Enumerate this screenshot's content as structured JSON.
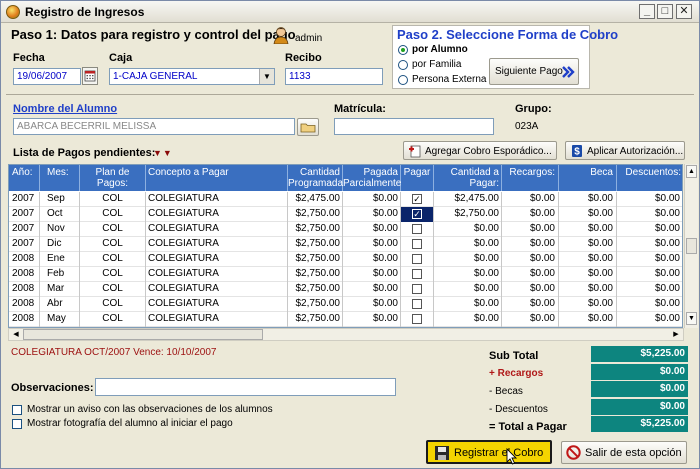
{
  "window": {
    "title": "Registro de Ingresos"
  },
  "step1": {
    "heading": "Paso 1: Datos para registro y control del pago",
    "user": "admin",
    "fecha_label": "Fecha",
    "fecha_value": "19/06/2007",
    "caja_label": "Caja",
    "caja_value": "1-CAJA GENERAL",
    "recibo_label": "Recibo",
    "recibo_value": "1133"
  },
  "step2": {
    "heading": "Paso 2. Seleccione Forma de Cobro",
    "options": [
      "por Alumno",
      "por Familia",
      "Persona Externa"
    ],
    "selected": "por Alumno",
    "next_button": "Siguiente Pago"
  },
  "student": {
    "name_label": "Nombre del Alumno",
    "name_value": "ABARCA BECERRIL MELISSA",
    "matricula_label": "Matrícula:",
    "matricula_value": "",
    "grupo_label": "Grupo:",
    "grupo_value": "023A"
  },
  "list": {
    "label": "Lista de Pagos pendientes:",
    "add_button": "Agregar Cobro Esporádico...",
    "auth_button": "Aplicar Autorización..."
  },
  "table": {
    "headers": [
      "Año:",
      "Mes:",
      "Plan de Pagos:",
      "Concepto a Pagar",
      "Cantidad Programada",
      "Pagada Parcialmente",
      "Pagar",
      "Cantidad a Pagar:",
      "Recargos:",
      "Beca",
      "Descuentos:"
    ],
    "rows": [
      {
        "anio": "2007",
        "mes": "Sep",
        "plan": "COL",
        "concepto": "COLEGIATURA",
        "programada": "$2,475.00",
        "parcial": "$0.00",
        "pagar": true,
        "cantidad": "$2,475.00",
        "recargos": "$0.00",
        "beca": "$0.00",
        "descuentos": "$0.00"
      },
      {
        "anio": "2007",
        "mes": "Oct",
        "plan": "COL",
        "concepto": "COLEGIATURA",
        "programada": "$2,750.00",
        "parcial": "$0.00",
        "pagar": true,
        "cantidad": "$2,750.00",
        "recargos": "$0.00",
        "beca": "$0.00",
        "descuentos": "$0.00"
      },
      {
        "anio": "2007",
        "mes": "Nov",
        "plan": "COL",
        "concepto": "COLEGIATURA",
        "programada": "$2,750.00",
        "parcial": "$0.00",
        "pagar": false,
        "cantidad": "$0.00",
        "recargos": "$0.00",
        "beca": "$0.00",
        "descuentos": "$0.00"
      },
      {
        "anio": "2007",
        "mes": "Dic",
        "plan": "COL",
        "concepto": "COLEGIATURA",
        "programada": "$2,750.00",
        "parcial": "$0.00",
        "pagar": false,
        "cantidad": "$0.00",
        "recargos": "$0.00",
        "beca": "$0.00",
        "descuentos": "$0.00"
      },
      {
        "anio": "2008",
        "mes": "Ene",
        "plan": "COL",
        "concepto": "COLEGIATURA",
        "programada": "$2,750.00",
        "parcial": "$0.00",
        "pagar": false,
        "cantidad": "$0.00",
        "recargos": "$0.00",
        "beca": "$0.00",
        "descuentos": "$0.00"
      },
      {
        "anio": "2008",
        "mes": "Feb",
        "plan": "COL",
        "concepto": "COLEGIATURA",
        "programada": "$2,750.00",
        "parcial": "$0.00",
        "pagar": false,
        "cantidad": "$0.00",
        "recargos": "$0.00",
        "beca": "$0.00",
        "descuentos": "$0.00"
      },
      {
        "anio": "2008",
        "mes": "Mar",
        "plan": "COL",
        "concepto": "COLEGIATURA",
        "programada": "$2,750.00",
        "parcial": "$0.00",
        "pagar": false,
        "cantidad": "$0.00",
        "recargos": "$0.00",
        "beca": "$0.00",
        "descuentos": "$0.00"
      },
      {
        "anio": "2008",
        "mes": "Abr",
        "plan": "COL",
        "concepto": "COLEGIATURA",
        "programada": "$2,750.00",
        "parcial": "$0.00",
        "pagar": false,
        "cantidad": "$0.00",
        "recargos": "$0.00",
        "beca": "$0.00",
        "descuentos": "$0.00"
      },
      {
        "anio": "2008",
        "mes": "May",
        "plan": "COL",
        "concepto": "COLEGIATURA",
        "programada": "$2,750.00",
        "parcial": "$0.00",
        "pagar": false,
        "cantidad": "$0.00",
        "recargos": "$0.00",
        "beca": "$0.00",
        "descuentos": "$0.00"
      }
    ]
  },
  "footer": {
    "info": "COLEGIATURA OCT/2007 Vence: 10/10/2007",
    "observaciones_label": "Observaciones:",
    "observaciones_value": "",
    "check1": "Mostrar un aviso con las observaciones de los alumnos",
    "check2": "Mostrar fotografía del alumno al iniciar el pago"
  },
  "totals": {
    "subtotal_label": "Sub Total",
    "subtotal_value": "$5,225.00",
    "recargos_label": "+ Recargos",
    "recargos_value": "$0.00",
    "becas_label": "- Becas",
    "becas_value": "$0.00",
    "descuentos_label": "- Descuentos",
    "descuentos_value": "$0.00",
    "total_label": "= Total a Pagar",
    "total_value": "$5,225.00"
  },
  "actions": {
    "register_button": "Registrar el Cobro",
    "exit_button": "Salir de esta opción"
  },
  "colors": {
    "teal": "#0d857f",
    "header_blue": "#3a6fc0",
    "step2_blue": "#1f3fc8",
    "due_red": "#9c1010"
  }
}
